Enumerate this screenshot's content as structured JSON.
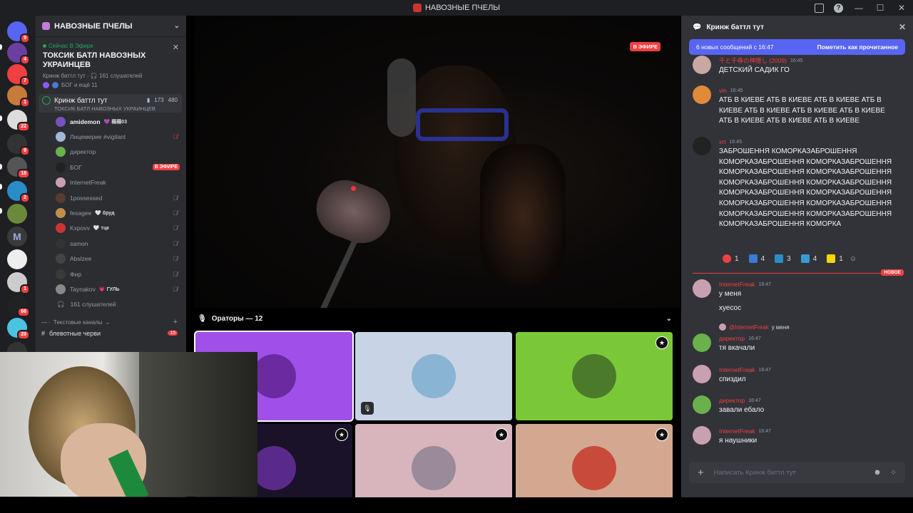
{
  "window": {
    "title": "НАВОЗНЫЕ ПЧЕЛЫ"
  },
  "rail": {
    "servers": [
      {
        "color": "#5865f2",
        "badge": "9"
      },
      {
        "color": "#6b3fa0",
        "badge": "4"
      },
      {
        "color": "#f23f42",
        "badge": "7"
      },
      {
        "color": "#c77b3a",
        "badge": "1"
      },
      {
        "color": "#ddd",
        "badge": "22"
      },
      {
        "color": "#333",
        "badge": "9"
      },
      {
        "color": "#555",
        "badge": "18"
      },
      {
        "color": "#2a8cc7",
        "badge": "2"
      },
      {
        "color": "#6a8a3a",
        "badge": ""
      },
      {
        "color": "#3a3a3a",
        "badge": "",
        "letter": "M"
      },
      {
        "color": "#eee",
        "badge": ""
      },
      {
        "color": "#ccc",
        "badge": "1"
      },
      {
        "color": "#222",
        "badge": "66"
      },
      {
        "color": "#4ac3e0",
        "badge": "29"
      },
      {
        "color": "#333",
        "badge": ""
      }
    ]
  },
  "sidebar": {
    "server_name": "НАВОЗНЫЕ ПЧЕЛЫ",
    "live": {
      "tag": "Сейчас В Эфире",
      "title": "ТОКСИК БАТЛ НАВОЗНЫХ УКРАИНЦЕВ",
      "meta": "Кринж баттл тут · 🎧 161 слушателей",
      "who": "БОГ и ещё 11"
    },
    "stage": {
      "name": "Кринж баттл тут",
      "sub": "ТОКСИК БАТЛ НАВОЗНЫХ УКРАИНЦЕВ",
      "video_count": "173",
      "user_count": "480"
    },
    "members": [
      {
        "name": "amidemon",
        "tag": "💜 楊楊03",
        "color": "#7a4fbf",
        "active": true,
        "status": ""
      },
      {
        "name": "Лицемерие #vigilant",
        "tag": "",
        "color": "#9fb8d8",
        "active": false,
        "status": "mute-red"
      },
      {
        "name": "директор",
        "tag": "",
        "color": "#6ab04c",
        "active": false,
        "status": ""
      },
      {
        "name": "БОГ",
        "tag": "",
        "color": "#222",
        "active": false,
        "status": "live"
      },
      {
        "name": "InternetFreak",
        "tag": "",
        "color": "#c9a0b0",
        "active": false,
        "status": ""
      },
      {
        "name": "1possessed",
        "tag": "",
        "color": "#5a3a2a",
        "active": false,
        "status": "mute"
      },
      {
        "name": "fesagee",
        "tag": "🤍 бруд",
        "color": "#c0904a",
        "active": false,
        "status": "mute"
      },
      {
        "name": "Kxpovv",
        "tag": "🤍 тцк",
        "color": "#c33",
        "active": false,
        "status": "mute"
      },
      {
        "name": "samon",
        "tag": "",
        "color": "#333",
        "active": false,
        "status": "mute"
      },
      {
        "name": "Abslzee",
        "tag": "",
        "color": "#444",
        "active": false,
        "status": "mute"
      },
      {
        "name": "Фир",
        "tag": "",
        "color": "#3a3a3a",
        "active": false,
        "status": "mute"
      },
      {
        "name": "Taynakov",
        "tag": "💗 ГУЛЬ",
        "color": "#888",
        "active": false,
        "status": "mute"
      }
    ],
    "listeners": "161 слушателей",
    "category": "Текстовые каналы",
    "channel": "блевотные черви",
    "channel_badge": "15",
    "live_label": "В ЭФИРЕ"
  },
  "stage": {
    "on_air": "В ЭФИРЕ",
    "speakers_label": "Ораторы — 12",
    "tiles": [
      {
        "bg": "#a050e8",
        "av": "#6a2aa0",
        "selected": true,
        "badge": false,
        "mic": false
      },
      {
        "bg": "#c8d4e6",
        "av": "#8ab4d4",
        "selected": false,
        "badge": false,
        "mic": true
      },
      {
        "bg": "#7ac838",
        "av": "#4a7a2a",
        "selected": false,
        "badge": true,
        "mic": false
      },
      {
        "bg": "#1a1228",
        "av": "#5a2a8a",
        "selected": false,
        "badge": true,
        "mic": false
      },
      {
        "bg": "#d8b4bc",
        "av": "#9a8a9a",
        "selected": false,
        "badge": true,
        "mic": false
      },
      {
        "bg": "#d4a890",
        "av": "#c84a3a",
        "selected": false,
        "badge": true,
        "mic": false
      }
    ]
  },
  "thread": {
    "title": "Кринж баттл тут",
    "new_bar": "6 новых сообщений с 16:47",
    "mark_read": "Пометить как прочитанное",
    "messages": [
      {
        "name": "千と千尋の神隠し (2009)",
        "time": "16:45",
        "body": "ДЕТСКИЙ САДИК ГО",
        "color": "#c8a8a0"
      },
      {
        "name": "vin",
        "time": "16:45",
        "body": "АТБ В КИЕВЕ АТБ В КИЕВЕ АТБ В КИЕВЕ АТБ В КИЕВЕ АТБ В КИЕВЕ АТБ В КИЕВЕ АТБ В КИЕВЕ АТБ В КИЕВЕ АТБ В КИЕВЕ АТБ В КИЕВЕ",
        "color": "#e08a3a"
      },
      {
        "name": "xrt",
        "time": "16:45",
        "body": "ЗАБРОШЕННЯ КОМОРКАЗАБРОШЕННЯ КОМОРКАЗАБРОШЕННЯ КОМОРКАЗАБРОШЕННЯ КОМОРКАЗАБРОШЕННЯ КОМОРКАЗАБРОШЕННЯ КОМОРКАЗАБРОШЕННЯ КОМОРКАЗАБРОШЕННЯ КОМОРКАЗАБРОШЕННЯ КОМОРКАЗАБРОШЕННЯ КОМОРКАЗАБРОШЕННЯ КОМОРКАЗАБРОШЕННЯ КОМОРКАЗАБРОШЕННЯ КОМОРКАЗАБРОШЕННЯ КОМОРКАЗАБРОШЕННЯ КОМОРКА",
        "color": "#222"
      },
      {
        "name": "InternetFreak",
        "time": "16:47",
        "body": "у меня",
        "color": "#c9a0b0"
      },
      {
        "name": "",
        "time": "",
        "body": "хуесос",
        "color": ""
      },
      {
        "name": "директор",
        "time": "16:47",
        "body": "тя вкачали",
        "color": "#6ab04c"
      },
      {
        "name": "InternetFreak",
        "time": "16:47",
        "body": "спиздил",
        "color": "#c9a0b0"
      },
      {
        "name": "директор",
        "time": "16:47",
        "body": "завали ебало",
        "color": "#6ab04c"
      },
      {
        "name": "InternetFreak",
        "time": "16:47",
        "body": "я наушники",
        "color": "#c9a0b0"
      }
    ],
    "reactions": [
      {
        "emoji": "heart",
        "color": "#f23f42",
        "count": "1"
      },
      {
        "emoji": "Z",
        "color": "#3a7bd5",
        "count": "4"
      },
      {
        "emoji": "O",
        "color": "#2a8cc7",
        "count": "3"
      },
      {
        "emoji": "V",
        "color": "#3a9ad5",
        "count": "4"
      },
      {
        "emoji": "flag-ua",
        "color": "#ffd500",
        "count": "1"
      }
    ],
    "new_label": "НОВОЕ",
    "reply_name": "@InternetFreak",
    "reply_text": "у меня",
    "composer_placeholder": "Написать Кринж баттл тут"
  }
}
